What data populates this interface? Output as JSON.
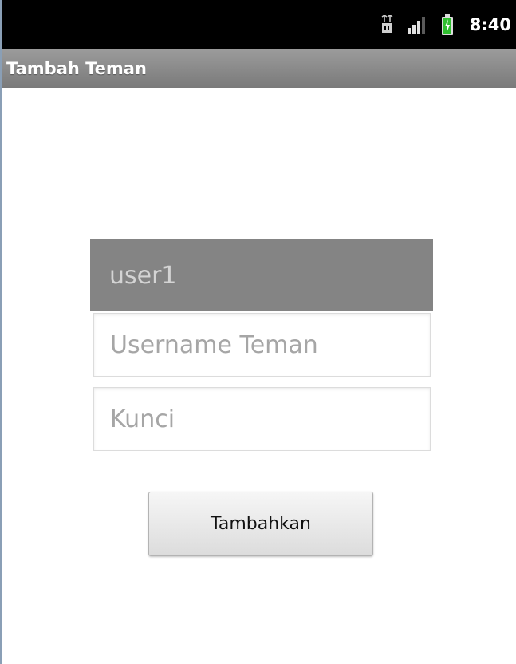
{
  "status_bar": {
    "time": "8:40",
    "icons": [
      "usb-debug-icon",
      "signal-icon",
      "battery-charging-icon"
    ]
  },
  "app": {
    "title": "Tambah Teman"
  },
  "form": {
    "current_user": "user1",
    "friend_username_placeholder": "Username Teman",
    "key_placeholder": "Kunci",
    "submit_label": "Tambahkan"
  },
  "colors": {
    "status_bar_bg": "#000000",
    "title_bar_bg": "#8a8a8a",
    "user_field_bg": "#848484",
    "placeholder_text": "#a6a6a6"
  }
}
